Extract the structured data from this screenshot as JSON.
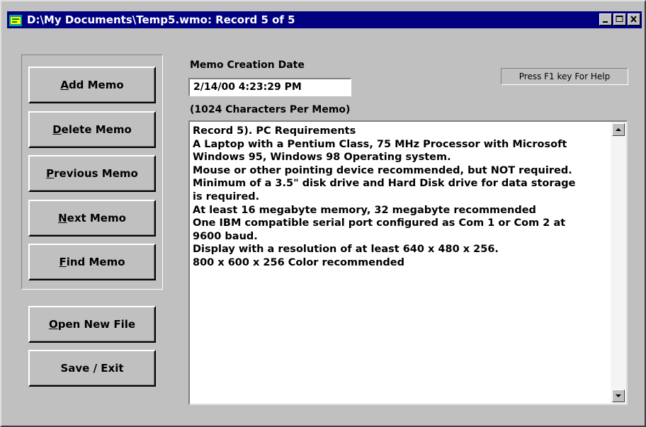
{
  "window": {
    "title": "D:\\My Documents\\Temp5.wmo: Record  5 of  5"
  },
  "buttons": {
    "add_memo": {
      "accel": "A",
      "rest": "dd Memo"
    },
    "delete_memo": {
      "accel": "D",
      "rest": "elete Memo"
    },
    "previous_memo": {
      "accel": "P",
      "rest": "revious Memo"
    },
    "next_memo": {
      "accel": "N",
      "rest": "ext Memo"
    },
    "find_memo": {
      "accel": "F",
      "rest": "ind Memo"
    },
    "open_new_file": {
      "accel": "O",
      "rest": "pen New File"
    },
    "save_exit": {
      "label": "Save / Exit"
    }
  },
  "form": {
    "creation_date_label": "Memo Creation Date",
    "creation_date_value": "2/14/00 4:23:29 PM",
    "memo_limit_label": "(1024 Characters Per Memo)",
    "help_hint": "Press F1 key For Help"
  },
  "memo": {
    "lines": [
      "Record 5). PC Requirements",
      "A Laptop with a Pentium Class, 75 MHz Processor with Microsoft",
      "Windows 95, Windows 98 Operating system.",
      "Mouse or other pointing device recommended, but NOT required.",
      "Minimum of a 3.5\" disk drive and Hard Disk drive for data storage",
      "is required.",
      "At least 16 megabyte memory, 32 megabyte recommended",
      "One IBM compatible serial port configured as Com 1 or Com 2 at",
      "9600 baud.",
      "Display with a resolution of at least 640 x 480 x 256.",
      "800 x 600 x 256 Color recommended"
    ]
  },
  "colors": {
    "titlebar": "#000080",
    "face": "#c0c0c0"
  },
  "icons": {
    "app": "app-icon",
    "minimize": "minimize-icon",
    "maximize": "maximize-icon",
    "close": "close-icon",
    "scroll_up": "scroll-up-arrow-icon",
    "scroll_down": "scroll-down-arrow-icon"
  }
}
